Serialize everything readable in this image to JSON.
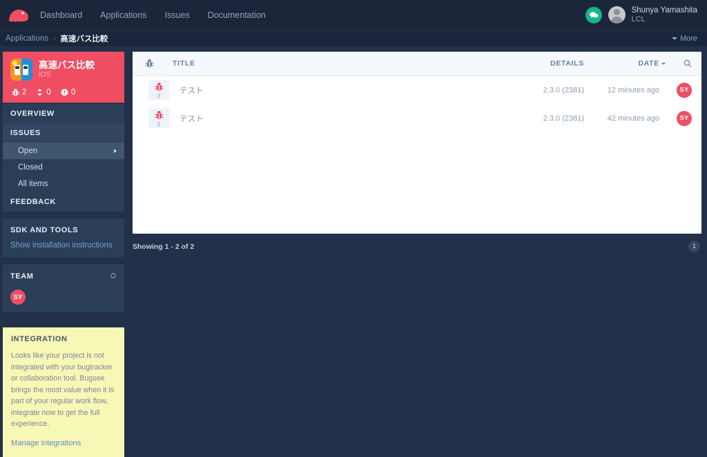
{
  "topnav": {
    "logo_icon": "bugsee-bug-logo",
    "links": [
      {
        "label": "Dashboard"
      },
      {
        "label": "Applications"
      },
      {
        "label": "Issues"
      },
      {
        "label": "Documentation"
      }
    ],
    "chat_icon": "chat-bubble-icon",
    "avatar_icon": "user-avatar-icon",
    "user_name": "Shunya Yamashita",
    "user_org": "LCL"
  },
  "breadcrumb": {
    "parent": "Applications",
    "separator": "›",
    "current": "高速バス比較",
    "more_label": "More"
  },
  "sidebar": {
    "app": {
      "icon": "bus-comparison-app-icon",
      "name": "高速バス比較",
      "platform": "iOS",
      "stats": [
        {
          "icon": "bug-icon",
          "value": "2"
        },
        {
          "icon": "feedback-icon",
          "value": "0"
        },
        {
          "icon": "crash-alert-icon",
          "value": "0"
        }
      ]
    },
    "menu": [
      {
        "label": "OVERVIEW",
        "type": "head"
      },
      {
        "label": "ISSUES",
        "type": "head-active"
      },
      {
        "label": "Open",
        "type": "item",
        "active": true
      },
      {
        "label": "Closed",
        "type": "item",
        "active": false
      },
      {
        "label": "All items",
        "type": "item",
        "active": false
      },
      {
        "label": "FEEDBACK",
        "type": "head"
      }
    ],
    "sdk_panel": {
      "title": "SDK AND TOOLS",
      "link": "Show installation instructions"
    },
    "team_panel": {
      "title": "TEAM",
      "settings_icon": "gear-icon",
      "members": [
        {
          "initials": "SY"
        }
      ]
    },
    "integration_panel": {
      "title": "INTEGRATION",
      "body": "Looks like your project is not integrated with your bugtracker or collaboration tool. Bugsee brings the most value when it is part of your regular work flow, integrate now to get the full experience.",
      "link": "Manage integrations"
    }
  },
  "table": {
    "columns": {
      "icon": "bug-icon",
      "title": "TITLE",
      "details": "DETAILS",
      "date": "DATE",
      "search_icon": "search-icon"
    },
    "rows": [
      {
        "icon": "bug-icon",
        "count": "2",
        "title": "テスト",
        "details": "2.3.0 (2381)",
        "date": "12 minutes ago",
        "avatar": "SY"
      },
      {
        "icon": "bug-icon",
        "count": "1",
        "title": "テスト",
        "details": "2.3.0 (2381)",
        "date": "42 minutes ago",
        "avatar": "SY"
      }
    ],
    "showing": "Showing 1 - 2 of 2",
    "page": "1"
  },
  "colors": {
    "background": "#22304a",
    "topnav": "#1b263b",
    "accent": "#ef4e63",
    "panel": "#2b3e57",
    "integration": "#f7f7b6"
  }
}
